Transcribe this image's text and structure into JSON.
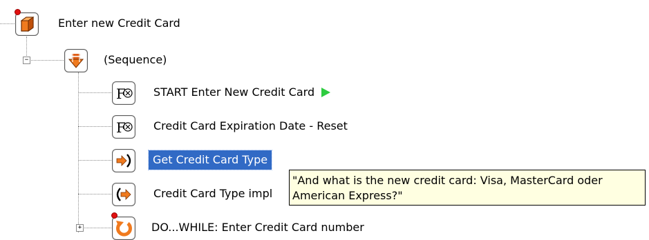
{
  "tree": {
    "root": {
      "label": "Enter new Credit Card",
      "icon": "cube-icon"
    },
    "sequence": {
      "label": "(Sequence)",
      "icon": "sequence-icon",
      "expander": "−"
    },
    "items": [
      {
        "label": "START Enter New Credit Card",
        "icon": "function-icon",
        "badge_icon": "play-icon"
      },
      {
        "label": "Credit Card Expiration Date - Reset",
        "icon": "function-icon"
      },
      {
        "label": "Get Credit Card Type",
        "icon": "input-arrow-icon",
        "selected": true
      },
      {
        "label": "Credit Card Type impl",
        "icon": "output-arrow-icon"
      },
      {
        "label": "DO...WHILE: Enter Credit Card number",
        "icon": "loop-icon",
        "expander": "+"
      }
    ]
  },
  "tooltip": {
    "line1": "\"And what is the new credit card: Visa, MasterCard oder",
    "line2": "American Express?\""
  },
  "colors": {
    "selection": "#316ac5",
    "tooltip_bg": "#ffffe1",
    "accent_orange": "#f07a1e",
    "status_red": "#e01010",
    "play_green": "#2ecc40"
  }
}
